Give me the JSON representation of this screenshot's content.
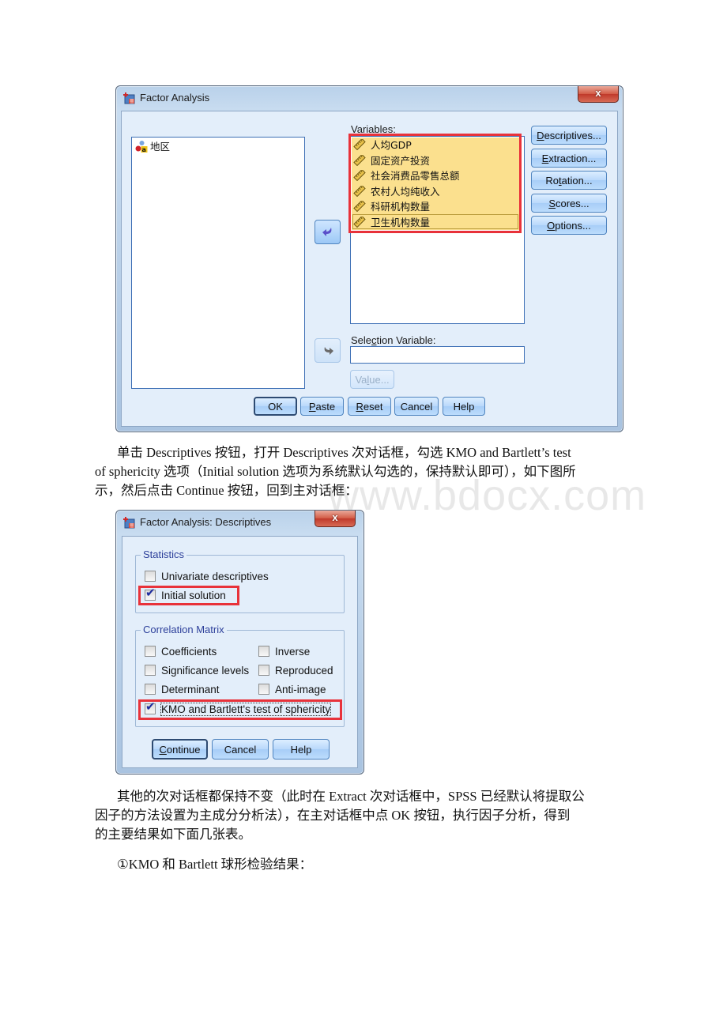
{
  "watermark": "www.bdocx.com",
  "colors": {
    "highlight_box": "#e8323a",
    "selection_fill": "#fbe08e",
    "dialog_body": "#e3eefa",
    "group_label": "#2c3f9a"
  },
  "main_dialog": {
    "title": "Factor Analysis",
    "icon": "spss-dialog-icon",
    "close_label": "x",
    "source_list": {
      "items": [
        {
          "label": "地区",
          "icon": "nominal-string-variable-icon"
        }
      ]
    },
    "variables_label_pre": "",
    "variables_label_ul": "V",
    "variables_label_post": "ariables:",
    "variables": [
      {
        "label": "人均GDP",
        "icon": "scale-ruler-icon"
      },
      {
        "label": "固定资产投资",
        "icon": "scale-ruler-icon"
      },
      {
        "label": "社会消费品零售总额",
        "icon": "scale-ruler-icon"
      },
      {
        "label": "农村人均纯收入",
        "icon": "scale-ruler-icon"
      },
      {
        "label": "科研机构数量",
        "icon": "scale-ruler-icon"
      },
      {
        "label": "卫生机构数量",
        "icon": "scale-ruler-icon"
      }
    ],
    "side_buttons": [
      {
        "ul": "D",
        "rest": "escriptives...",
        "pre": ""
      },
      {
        "ul": "E",
        "rest": "xtraction...",
        "pre": ""
      },
      {
        "pre": "Ro",
        "ul": "t",
        "rest": "ation..."
      },
      {
        "pre": "",
        "ul": "S",
        "rest": "cores..."
      },
      {
        "pre": "",
        "ul": "O",
        "rest": "ptions..."
      }
    ],
    "selection_variable": {
      "pre": "Sele",
      "ul": "c",
      "post": "tion Variable:",
      "value": ""
    },
    "value_button": {
      "pre": "Va",
      "ul": "l",
      "post": "ue..."
    },
    "bottom_buttons": {
      "ok": "OK",
      "paste": {
        "ul": "P",
        "rest": "aste"
      },
      "reset": {
        "ul": "R",
        "rest": "eset"
      },
      "cancel": "Cancel",
      "help": "Help"
    }
  },
  "paragraph1": {
    "line1": "单击 Descriptives 按钮，打开 Descriptives 次对话框，勾选 KMO and Bartlett’s test",
    "line2": "of sphericity 选项（Initial solution 选项为系统默认勾选的，保持默认即可），如下图所",
    "line3": "示，然后点击 Continue 按钮，回到主对话框："
  },
  "descriptives_dialog": {
    "title": "Factor Analysis: Descriptives",
    "close_label": "x",
    "statistics": {
      "label": "Statistics",
      "univariate": {
        "ul": "U",
        "rest": "nivariate descriptives",
        "checked": false
      },
      "initial_solution": {
        "ul": "I",
        "rest": "nitial solution",
        "checked": true
      }
    },
    "correlation_matrix": {
      "label": "Correlation Matrix",
      "coefficients": {
        "ul": "C",
        "rest": "oefficients",
        "checked": false
      },
      "inverse": {
        "pre": "I",
        "ul": "n",
        "rest": "verse",
        "checked": false
      },
      "significance": {
        "ul": "S",
        "rest": "ignificance levels",
        "checked": false
      },
      "reproduced": {
        "ul": "R",
        "rest": "eproduced",
        "checked": false
      },
      "determinant": {
        "ul": "D",
        "rest": "eterminant",
        "checked": false
      },
      "anti_image": {
        "ul": "A",
        "rest": "nti-image",
        "checked": false
      },
      "kmo": {
        "ul": "K",
        "rest": "MO and Bartlett's test of sphericity",
        "checked": true
      }
    },
    "buttons": {
      "continue": {
        "ul": "C",
        "rest": "ontinue"
      },
      "cancel": "Cancel",
      "help": "Help"
    }
  },
  "paragraph2": {
    "line1": "其他的次对话框都保持不变（此时在 Extract 次对话框中，SPSS 已经默认将提取公",
    "line2": "因子的方法设置为主成分分析法），在主对话框中点 OK 按钮，执行因子分析，得到",
    "line3": "的主要结果如下面几张表。"
  },
  "paragraph3": {
    "line1": "①KMO 和 Bartlett 球形检验结果："
  }
}
